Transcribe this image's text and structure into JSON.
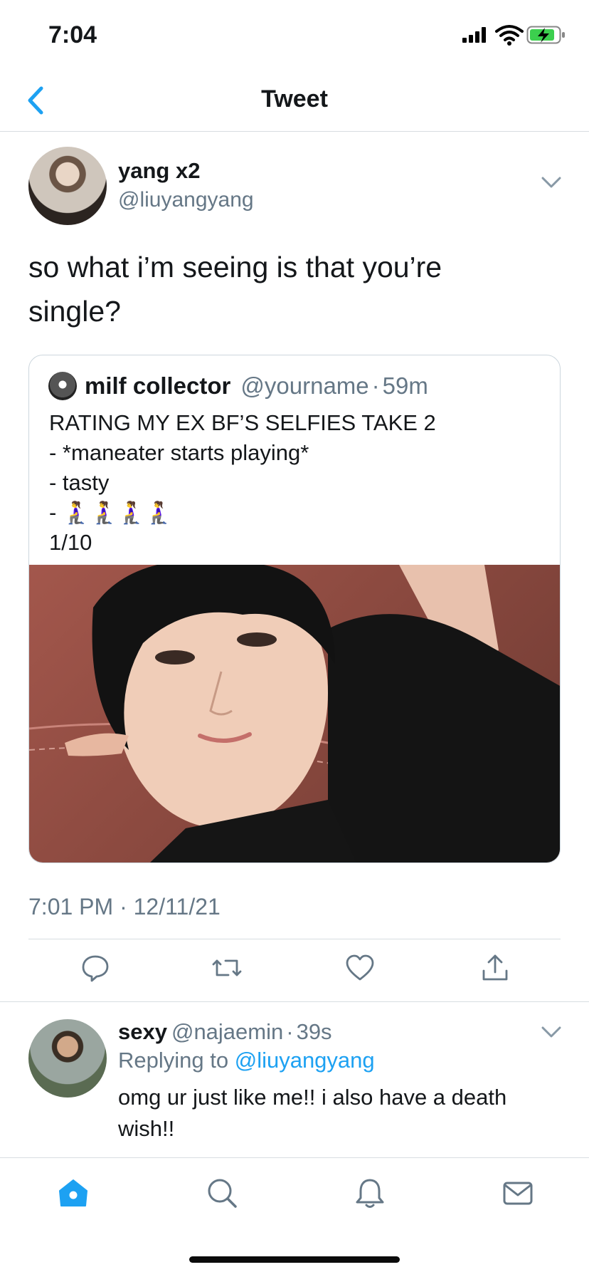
{
  "status_bar": {
    "time": "7:04"
  },
  "nav": {
    "title": "Tweet"
  },
  "tweet": {
    "author_name": "yang x2",
    "author_handle": "@liuyangyang",
    "text_line1": "so what i’m seeing is that you’re",
    "text_line2": "single?",
    "timestamp": "7:01 PM · 12/11/21"
  },
  "quote": {
    "name": "milf collector",
    "handle": "@yourname",
    "dot": "·",
    "time": "59m",
    "lines": [
      "RATING MY EX BF’S SELFIES TAKE 2",
      "- *maneater starts playing*",
      "- tasty",
      "- 🧎‍♀️🧎‍♀️🧎‍♀️🧎‍♀️",
      "1/10"
    ]
  },
  "reply": {
    "name": "sexy",
    "handle": "@najaemin",
    "dot": "·",
    "time": "39s",
    "replying_prefix": "Replying to ",
    "replying_handle": "@liuyangyang",
    "text": "omg ur just like me!! i also have a death wish!!"
  },
  "colors": {
    "accent": "#1da1f2",
    "secondary_text": "#657786",
    "divider": "#d8dde1",
    "home_tab": "#1da1f2"
  },
  "icons": {
    "back": "chevron-left-icon",
    "more": "chevron-down-icon",
    "reply": "comment-icon",
    "retweet": "retweet-icon",
    "like": "heart-icon",
    "share": "share-icon",
    "home": "home-icon",
    "search": "search-icon",
    "notifications": "bell-icon",
    "messages": "mail-icon"
  }
}
